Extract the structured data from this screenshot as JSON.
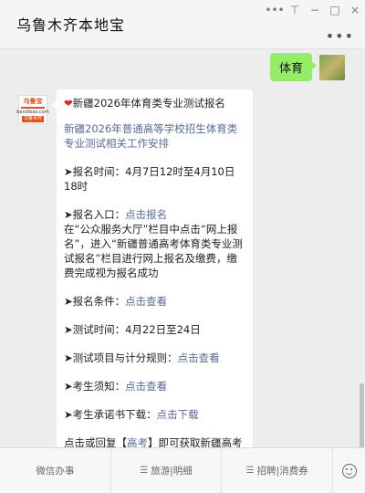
{
  "window": {
    "title": "乌鲁木齐本地宝",
    "controls": [
      "•••",
      "⊤",
      "−",
      "□",
      "×"
    ],
    "menu_icon": "•••"
  },
  "user_message": {
    "text": "体育"
  },
  "bot_avatar": {
    "logo_top": "乌鲁宝",
    "logo_sub": "bendibao.com",
    "logo_tag": "乌鲁木齐"
  },
  "bot_message": {
    "heart": "❤",
    "headline": "新疆2026年体育类专业测试报名",
    "article_link": "新疆2026年普通高等学校招生体育类专业测试相关工作安排",
    "reg_time_label": "➤报名时间：",
    "reg_time_value": "4月7日12时至4月10日18时",
    "reg_entry_label": "➤报名入口：",
    "reg_entry_link": "点击报名",
    "reg_entry_desc": "在“公众服务大厅”栏目中点击“网上报名”，进入“新疆普通高考体育类专业测试报名”栏目进行网上报名及缴费，缴费完成视为报名成功",
    "conditions_label": "➤报名条件：",
    "conditions_link": "点击查看",
    "test_time_label": "➤测试时间：",
    "test_time_value": "4月22日至24日",
    "items_label": "➤测试项目与计分规则：",
    "items_link": "点击查看",
    "notice_label": "➤考生须知：",
    "notice_link": "点击查看",
    "promise_label": "➤考生承诺书下载：",
    "promise_link": "点击下载",
    "footer_prefix": "点击或回复【",
    "footer_link": "高考",
    "footer_suffix": "】即可获取新疆高考成绩查询入口/录取信息"
  },
  "bottom_menu": {
    "keyboard_icon": "⌨",
    "tabs": [
      "微信办事",
      "旅游|明细",
      "招聘|消费券"
    ]
  },
  "colors": {
    "user_bubble": "#95ec69",
    "link": "#576b95",
    "background": "#ededed"
  }
}
